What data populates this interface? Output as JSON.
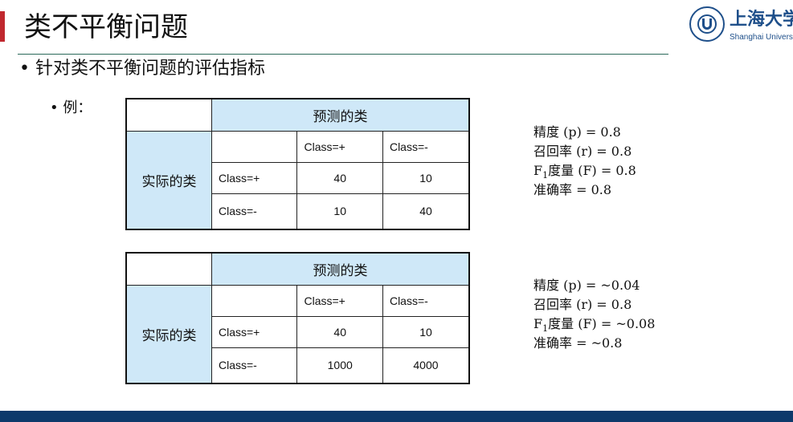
{
  "slide": {
    "title": "类不平衡问题",
    "bullet": "• 针对类不平衡问题的评估指标",
    "example_label": "• 例："
  },
  "logo": {
    "cn": "上海大学",
    "en": "Shanghai University",
    "seal_text": "SHANGHAI UNIVERSITY"
  },
  "tables": [
    {
      "predicted_header": "预测的类",
      "actual_header": "实际的类",
      "col_headers": [
        "Class=+",
        "Class=-"
      ],
      "rows": [
        {
          "label": "Class=+",
          "values": [
            "40",
            "10"
          ]
        },
        {
          "label": "Class=-",
          "values": [
            "10",
            "40"
          ]
        }
      ]
    },
    {
      "predicted_header": "预测的类",
      "actual_header": "实际的类",
      "col_headers": [
        "Class=+",
        "Class=-"
      ],
      "rows": [
        {
          "label": "Class=+",
          "values": [
            "40",
            "10"
          ]
        },
        {
          "label": "Class=-",
          "values": [
            "1000",
            "4000"
          ]
        }
      ]
    }
  ],
  "metrics": [
    {
      "precision": "精度 (p)  = 0.8",
      "recall": "召回率 (r) = 0.8",
      "f1_prefix": "F",
      "f1_sub": "1",
      "f1_rest": "度量 (F) = 0.8",
      "accuracy": "准确率  = 0.8"
    },
    {
      "precision": "精度 (p)  = ~0.04",
      "recall": "召回率 (r) = 0.8",
      "f1_prefix": "F",
      "f1_sub": "1",
      "f1_rest": "度量 (F) = ~0.08",
      "accuracy": "准确率  = ~0.8"
    }
  ],
  "colors": {
    "accent_red": "#c0282e",
    "header_fill": "#cfe8f8",
    "footer": "#0d3a6b",
    "brand_blue": "#1e4f8a"
  }
}
